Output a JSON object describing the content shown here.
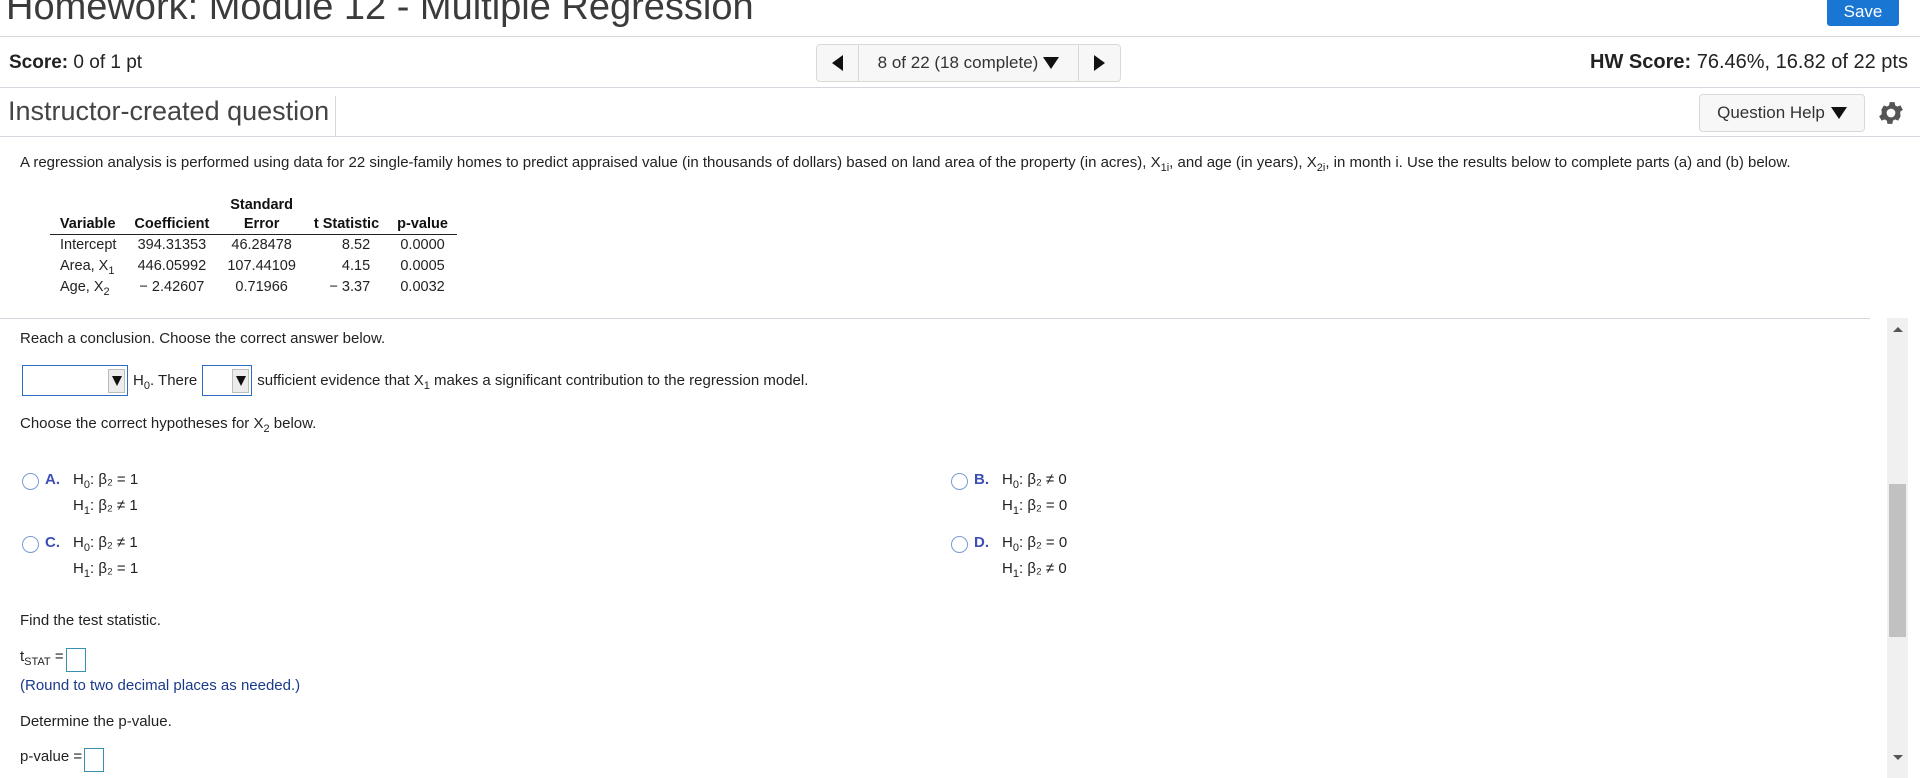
{
  "header": {
    "title": "Homework: Module 12 - Multiple Regression",
    "save_label": "Save"
  },
  "score_bar": {
    "score_label": "Score:",
    "score_value": "0 of 1 pt",
    "nav_label": "8 of 22 (18 complete)",
    "hw_score_label": "HW Score:",
    "hw_score_value": "76.46%, 16.82 of 22 pts"
  },
  "question_header": {
    "type": "Instructor-created question",
    "help_label": "Question Help"
  },
  "intro": {
    "part1": "A regression analysis is performed using data for 22 single-family homes to predict appraised value (in thousands of dollars) based on land area of the property (in acres), X",
    "sub1": "1i",
    "part2": ", and age (in years), X",
    "sub2": "2i",
    "part3": ", in month i. Use the results below to complete parts (a) and (b) below."
  },
  "table": {
    "headers_top": [
      "",
      "",
      "Standard",
      "",
      ""
    ],
    "headers": [
      "Variable",
      "Coefficient",
      "Error",
      "t Statistic",
      "p-value"
    ],
    "rows": [
      {
        "var": "Intercept",
        "var_sub": "",
        "coef": "394.31353",
        "se": "46.28478",
        "t": "8.52",
        "p": "0.0000"
      },
      {
        "var": "Area, X",
        "var_sub": "1",
        "coef": "446.05992",
        "se": "107.44109",
        "t": "4.15",
        "p": "0.0005"
      },
      {
        "var": "Age, X",
        "var_sub": "2",
        "coef": "− 2.42607",
        "se": "0.71966",
        "t": "− 3.37",
        "p": "0.0032"
      }
    ]
  },
  "conclusion": {
    "prompt": "Reach a conclusion. Choose the correct answer below.",
    "dropdown1_value": "",
    "h0": "H",
    "h0_sub": "0",
    "text_there": ". There",
    "dropdown2_value": "",
    "text_rest1": "sufficient evidence that X",
    "x_sub": "1",
    "text_rest2": " makes a significant contribution to the regression model."
  },
  "hypotheses": {
    "prompt_pre": "Choose the correct hypotheses for X",
    "prompt_sub": "2",
    "prompt_post": " below.",
    "choices": [
      {
        "letter": "A.",
        "h0": "β₂ = 1",
        "h1": "β₂ ≠ 1"
      },
      {
        "letter": "B.",
        "h0": "β₂ ≠ 0",
        "h1": "β₂ = 0"
      },
      {
        "letter": "C.",
        "h0": "β₂ ≠ 1",
        "h1": "β₂ = 1"
      },
      {
        "letter": "D.",
        "h0": "β₂ = 0",
        "h1": "β₂ ≠ 0"
      }
    ]
  },
  "test_stat": {
    "prompt": "Find the test statistic.",
    "label": "t",
    "label_sub": "STAT",
    "equals": " =",
    "value": "",
    "note": "(Round to two decimal places as needed.)"
  },
  "p_value": {
    "prompt": "Determine the p-value.",
    "label": "p-value =",
    "value": ""
  },
  "colors": {
    "save_button": "#1976d2",
    "choice_letter": "#3d4fb6",
    "note_text": "#1a3a8a",
    "dropdown_border": "#2b6cc4"
  }
}
